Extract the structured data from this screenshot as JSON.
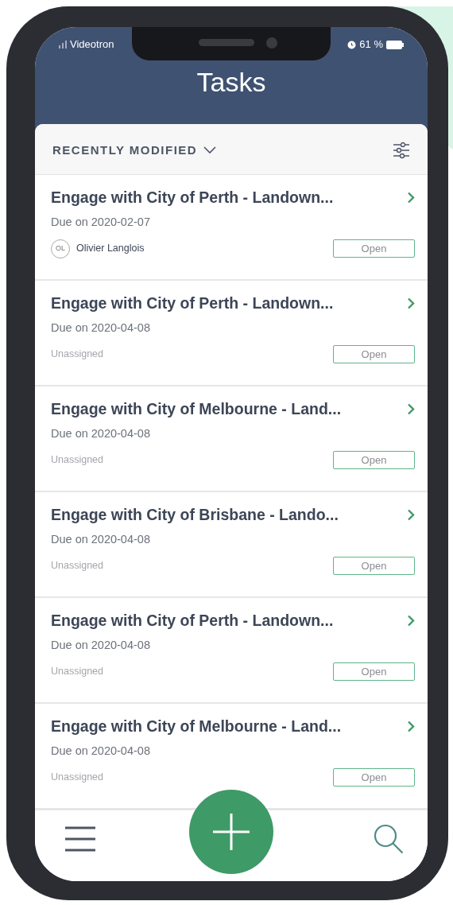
{
  "status_bar": {
    "carrier": "Videotron",
    "battery": "61 %"
  },
  "header": {
    "title": "Tasks"
  },
  "sort": {
    "label": "RECENTLY MODIFIED"
  },
  "tasks": [
    {
      "title": "Engage with City of Perth - Landown...",
      "due": "Due on 2020-02-07",
      "kind": "assigned",
      "initials": "OL",
      "assignee": "Olivier Langlois",
      "status": "Open"
    },
    {
      "title": "Engage with City of Perth - Landown...",
      "due": "Due on 2020-04-08",
      "kind": "unassigned",
      "assignee": "Unassigned",
      "status": "Open"
    },
    {
      "title": "Engage with City of Melbourne - Land...",
      "due": "Due on 2020-04-08",
      "kind": "unassigned",
      "assignee": "Unassigned",
      "status": "Open"
    },
    {
      "title": "Engage with City of Brisbane - Lando...",
      "due": "Due on 2020-04-08",
      "kind": "unassigned",
      "assignee": "Unassigned",
      "status": "Open"
    },
    {
      "title": "Engage with City of Perth - Landown...",
      "due": "Due on 2020-04-08",
      "kind": "unassigned",
      "assignee": "Unassigned",
      "status": "Open"
    },
    {
      "title": "Engage with City of Melbourne - Land...",
      "due": "Due on 2020-04-08",
      "kind": "unassigned",
      "assignee": "Unassigned",
      "status": "Open"
    }
  ]
}
